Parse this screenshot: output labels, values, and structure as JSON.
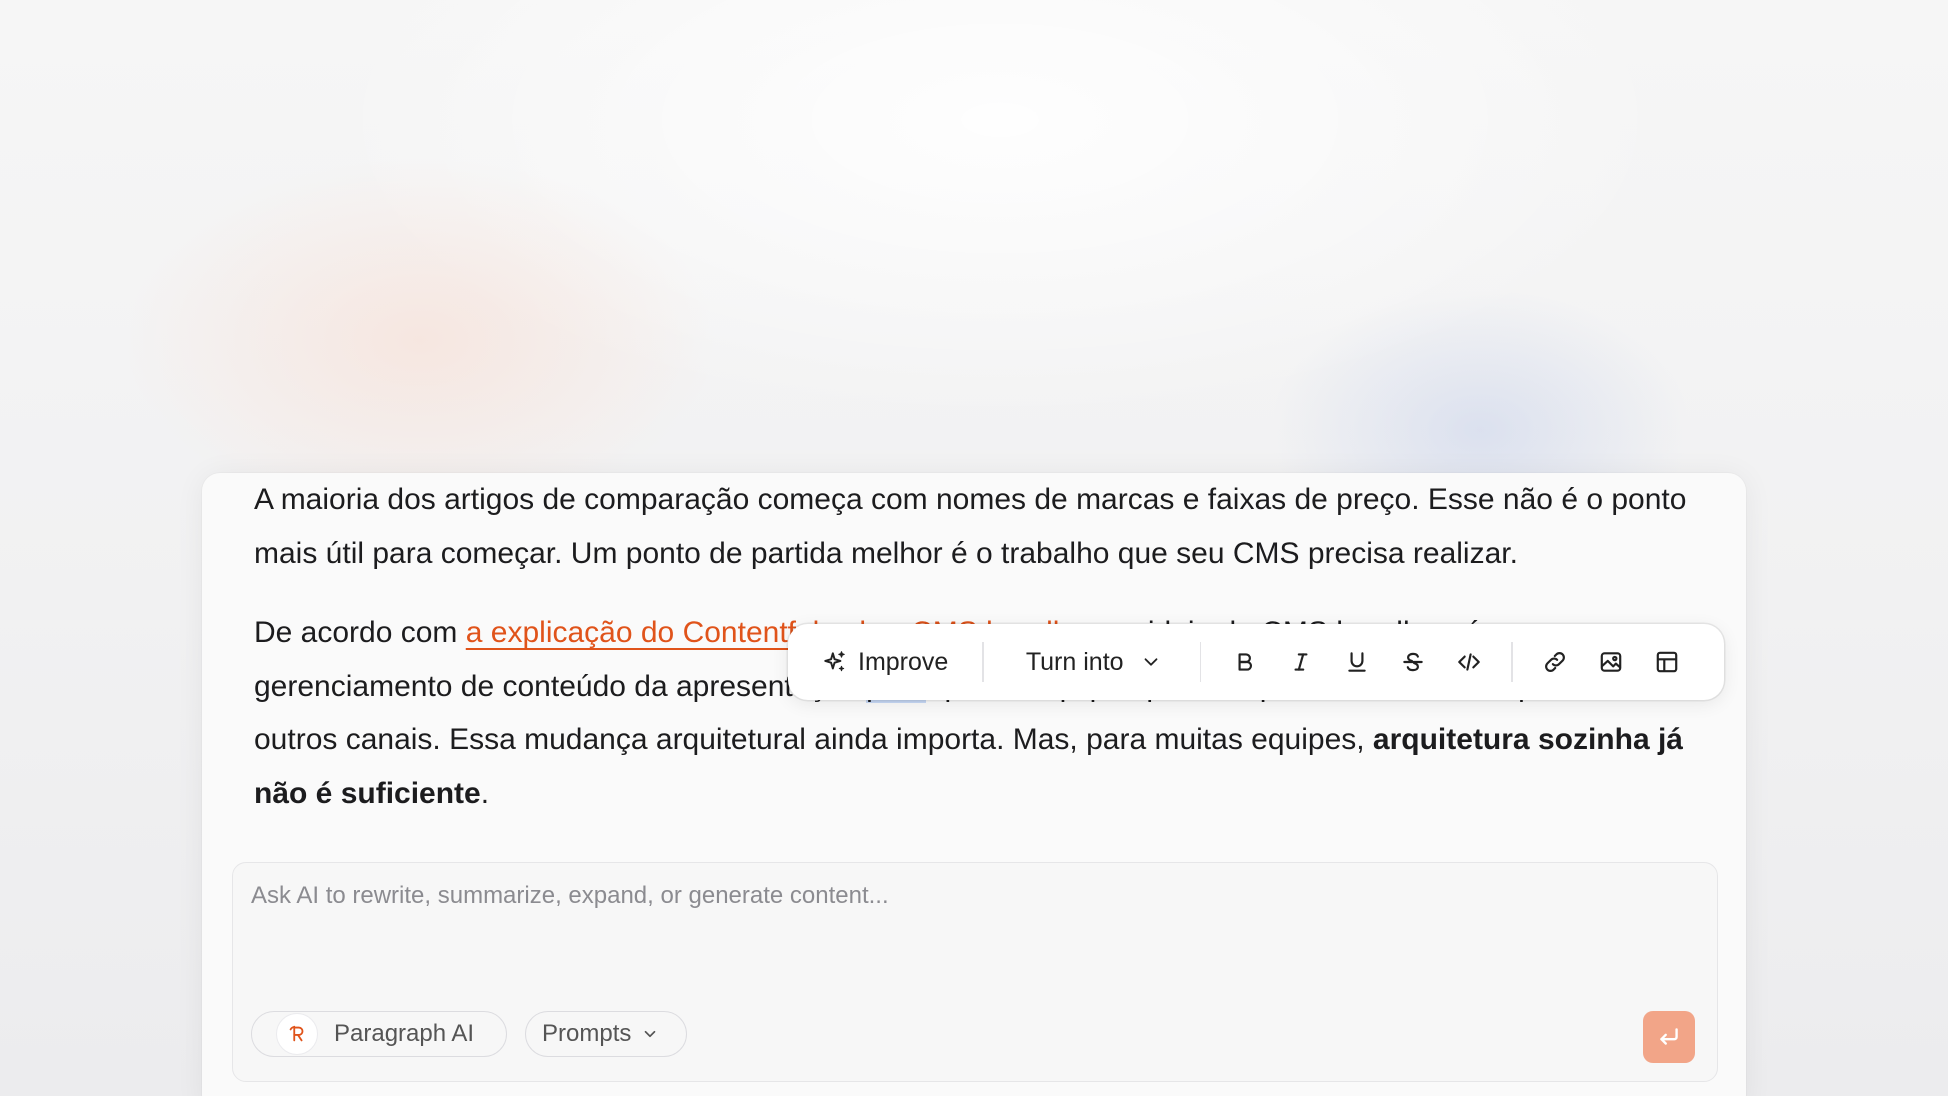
{
  "document": {
    "paragraph1": "A maioria dos artigos de comparação começa com nomes de marcas e faixas de preço. Esse não é o ponto mais útil para começar. Um ponto de partida melhor é o trabalho que seu CMS precisa realizar.",
    "paragraph2_start": "De acordo com ",
    "paragraph2_link": "a explicação do Contentful sobre CMS headless",
    "paragraph2_after_link": ", a ideia do CMS",
    "paragraph2_line2_before_selection": " headless é separar o gerenciamento de conteúdo da apresentação ",
    "paragraph2_selected": "para",
    "paragraph2_after_selection": " que as equipes possam publicar em sites, aplicativos e outros canais. Essa mudança arquitetural ainda importa. Mas, para muitas equipes, ",
    "paragraph2_bold": "arquitetura sozinha já não é suficiente",
    "paragraph2_end": "."
  },
  "toolbar": {
    "improve_label": "Improve",
    "turn_into_label": "Turn into",
    "icons": [
      "sparkle-icon",
      "chevron-down-icon",
      "bold-icon",
      "italic-icon",
      "underline-icon",
      "strikethrough-icon",
      "code-icon",
      "link-icon",
      "image-icon",
      "table-icon"
    ]
  },
  "ai_box": {
    "placeholder": "Ask AI to rewrite, summarize, expand, or generate content...",
    "value": "",
    "paragraph_ai_label": "Paragraph AI",
    "prompts_label": "Prompts",
    "send_icon": "enter-icon"
  },
  "colors": {
    "link": "#e0531a",
    "selection": "#c6d8f5",
    "send_button": "#f2a588"
  }
}
